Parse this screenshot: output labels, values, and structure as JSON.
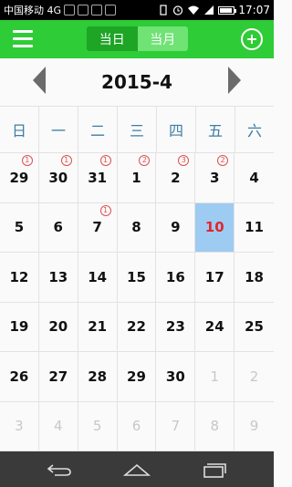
{
  "status": {
    "carrier": "中国移动 4G",
    "network_label": "4G",
    "time": "17:07"
  },
  "appbar": {
    "menu_icon": "menu-icon",
    "tab_day_label": "当日",
    "tab_month_label": "当月",
    "active_tab": "month",
    "add_icon": "add-icon",
    "accent_color": "#2ecc36"
  },
  "month": {
    "title": "2015-4"
  },
  "weekdays": [
    "日",
    "一",
    "二",
    "三",
    "四",
    "五",
    "六"
  ],
  "calendar": {
    "weeks": [
      [
        {
          "day": "29",
          "other": false,
          "badge": "1"
        },
        {
          "day": "30",
          "other": false,
          "badge": "1"
        },
        {
          "day": "31",
          "other": false,
          "badge": "1"
        },
        {
          "day": "1",
          "other": false,
          "badge": "2"
        },
        {
          "day": "2",
          "other": false,
          "badge": "3"
        },
        {
          "day": "3",
          "other": false,
          "badge": "2"
        },
        {
          "day": "4",
          "other": false,
          "badge": ""
        }
      ],
      [
        {
          "day": "5",
          "other": false,
          "badge": ""
        },
        {
          "day": "6",
          "other": false,
          "badge": ""
        },
        {
          "day": "7",
          "other": false,
          "badge": "1"
        },
        {
          "day": "8",
          "other": false,
          "badge": ""
        },
        {
          "day": "9",
          "other": false,
          "badge": ""
        },
        {
          "day": "10",
          "other": false,
          "badge": "",
          "today": true
        },
        {
          "day": "11",
          "other": false,
          "badge": ""
        }
      ],
      [
        {
          "day": "12",
          "other": false,
          "badge": ""
        },
        {
          "day": "13",
          "other": false,
          "badge": ""
        },
        {
          "day": "14",
          "other": false,
          "badge": ""
        },
        {
          "day": "15",
          "other": false,
          "badge": ""
        },
        {
          "day": "16",
          "other": false,
          "badge": ""
        },
        {
          "day": "17",
          "other": false,
          "badge": ""
        },
        {
          "day": "18",
          "other": false,
          "badge": ""
        }
      ],
      [
        {
          "day": "19",
          "other": false,
          "badge": ""
        },
        {
          "day": "20",
          "other": false,
          "badge": ""
        },
        {
          "day": "21",
          "other": false,
          "badge": ""
        },
        {
          "day": "22",
          "other": false,
          "badge": ""
        },
        {
          "day": "23",
          "other": false,
          "badge": ""
        },
        {
          "day": "24",
          "other": false,
          "badge": ""
        },
        {
          "day": "25",
          "other": false,
          "badge": ""
        }
      ],
      [
        {
          "day": "26",
          "other": false,
          "badge": ""
        },
        {
          "day": "27",
          "other": false,
          "badge": ""
        },
        {
          "day": "28",
          "other": false,
          "badge": ""
        },
        {
          "day": "29",
          "other": false,
          "badge": ""
        },
        {
          "day": "30",
          "other": false,
          "badge": ""
        },
        {
          "day": "1",
          "other": true,
          "badge": ""
        },
        {
          "day": "2",
          "other": true,
          "badge": ""
        }
      ],
      [
        {
          "day": "3",
          "other": true,
          "badge": ""
        },
        {
          "day": "4",
          "other": true,
          "badge": ""
        },
        {
          "day": "5",
          "other": true,
          "badge": ""
        },
        {
          "day": "6",
          "other": true,
          "badge": ""
        },
        {
          "day": "7",
          "other": true,
          "badge": ""
        },
        {
          "day": "8",
          "other": true,
          "badge": ""
        },
        {
          "day": "9",
          "other": true,
          "badge": ""
        }
      ]
    ]
  },
  "colors": {
    "today_bg": "#9ecbf2",
    "today_text": "#e0262b",
    "weekday_text": "#3d7ea3",
    "badge": "#e05050"
  },
  "navbar": {
    "back_icon": "back-icon",
    "home_icon": "home-icon",
    "recent_icon": "recent-apps-icon"
  }
}
